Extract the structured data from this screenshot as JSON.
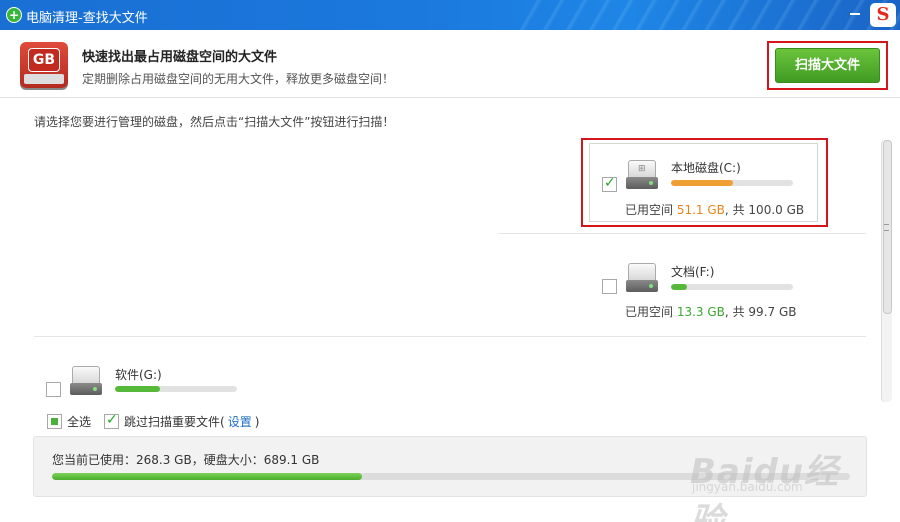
{
  "window": {
    "title": "电脑清理-查找大文件",
    "brand_logo_letter": "S"
  },
  "header": {
    "icon_label": "GB",
    "title": "快速找出最占用磁盘空间的大文件",
    "subtitle": "定期删除占用磁盘空间的无用大文件，释放更多磁盘空间！",
    "scan_button": "扫描大文件"
  },
  "instruction": "请选择您要进行管理的磁盘，然后点击“扫描大文件”按钮进行扫描！",
  "disks": [
    {
      "name": "本地磁盘(C:)",
      "checked": true,
      "used_label": "已用空间",
      "used": "51.1 GB",
      "total_label": "共",
      "total": "100.0 GB",
      "usage_fraction": 0.51,
      "bar_color": "#f0a033",
      "used_color": "#e8851a"
    },
    {
      "name": "文档(F:)",
      "checked": false,
      "used_label": "已用空间",
      "used": "13.3 GB",
      "total_label": "共",
      "total": "99.7 GB",
      "usage_fraction": 0.13,
      "bar_color": "#57b93a",
      "used_color": "#3aa92e"
    },
    {
      "name": "软件(G:)",
      "checked": false,
      "usage_fraction": 0.37,
      "bar_color": "#57b93a"
    }
  ],
  "options": {
    "select_all": "全选",
    "skip_important": "跳过扫描重要文件(",
    "settings_link": "设置",
    "close_paren": ")"
  },
  "usage": {
    "text": "您当前已使用：268.3 GB，硬盘大小：689.1 GB",
    "fraction": 0.389
  },
  "watermark": {
    "big": "Baidu经验",
    "small": "jingyan.baidu.com"
  }
}
